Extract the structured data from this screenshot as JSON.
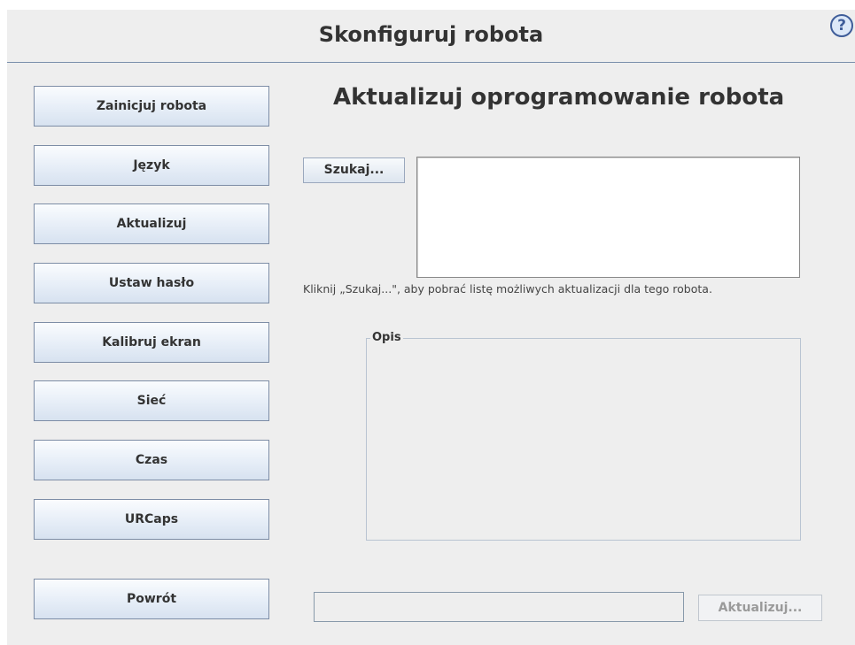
{
  "header": {
    "title": "Skonfiguruj robota",
    "help_icon": "?"
  },
  "sidebar": {
    "items": [
      {
        "label": "Zainicjuj robota"
      },
      {
        "label": "Język"
      },
      {
        "label": "Aktualizuj"
      },
      {
        "label": "Ustaw hasło"
      },
      {
        "label": "Kalibruj ekran"
      },
      {
        "label": "Sieć"
      },
      {
        "label": "Czas"
      },
      {
        "label": "URCaps"
      }
    ],
    "back_label": "Powrót"
  },
  "main": {
    "title": "Aktualizuj oprogramowanie robota",
    "search_label": "Szukaj...",
    "hint": "Kliknij „Szukaj...\", aby pobrać listę możliwych aktualizacji dla tego robota.",
    "description_legend": "Opis",
    "update_label": "Aktualizuj..."
  },
  "colors": {
    "accent_border": "#7a8fab",
    "background": "#eeeeee"
  }
}
